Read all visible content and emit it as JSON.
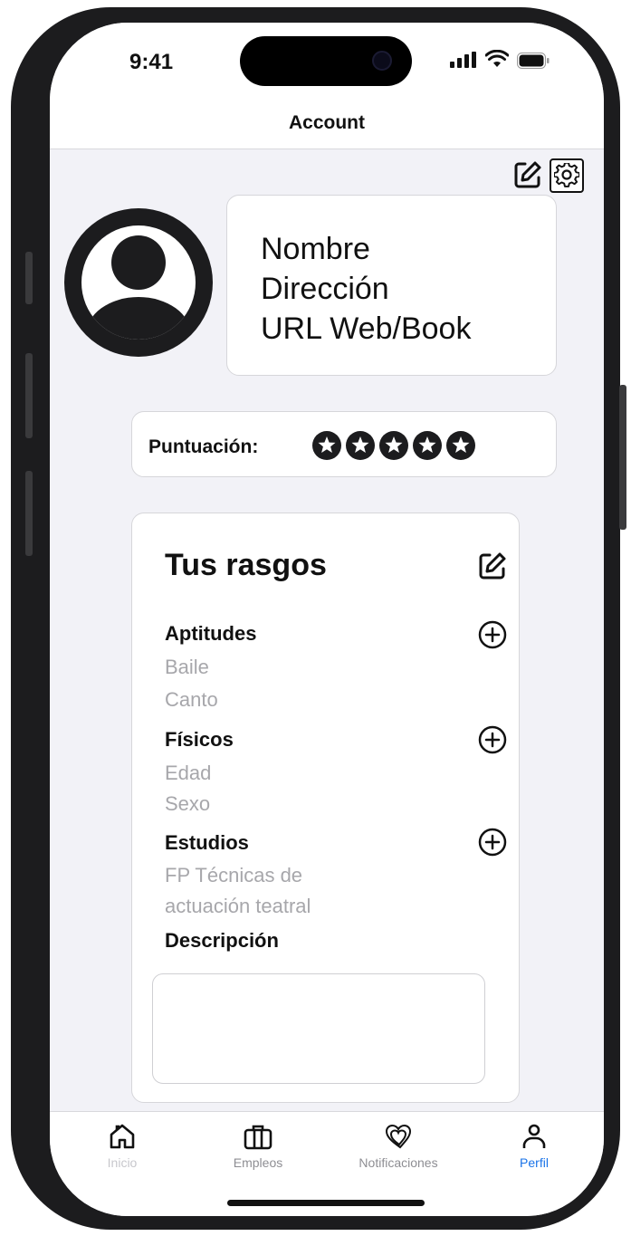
{
  "status_bar": {
    "time": "9:41"
  },
  "header": {
    "title": "Account"
  },
  "profile": {
    "name": "Nombre",
    "address": "Dirección",
    "url": "URL Web/Book"
  },
  "rating": {
    "label": "Puntuación:",
    "stars": 5,
    "max": 5
  },
  "traits": {
    "title": "Tus rasgos",
    "sections": [
      {
        "title": "Aptitudes",
        "items": [
          "Baile",
          "Canto"
        ]
      },
      {
        "title": "Físicos",
        "items": [
          "Edad",
          "Sexo"
        ]
      },
      {
        "title": "Estudios",
        "items": [
          "FP Técnicas de",
          "actuación teatral"
        ]
      }
    ],
    "description_label": "Descripción",
    "description_value": ""
  },
  "tabs": [
    {
      "label": "Inicio",
      "icon": "home-icon"
    },
    {
      "label": "Empleos",
      "icon": "briefcase-icon"
    },
    {
      "label": "Notificaciones",
      "icon": "hearts-icon"
    },
    {
      "label": "Perfil",
      "icon": "person-icon",
      "active": true
    }
  ],
  "colors": {
    "accent": "#1a73e8",
    "text": "#111111",
    "muted": "#a7a7ab",
    "background": "#f2f2f7"
  }
}
